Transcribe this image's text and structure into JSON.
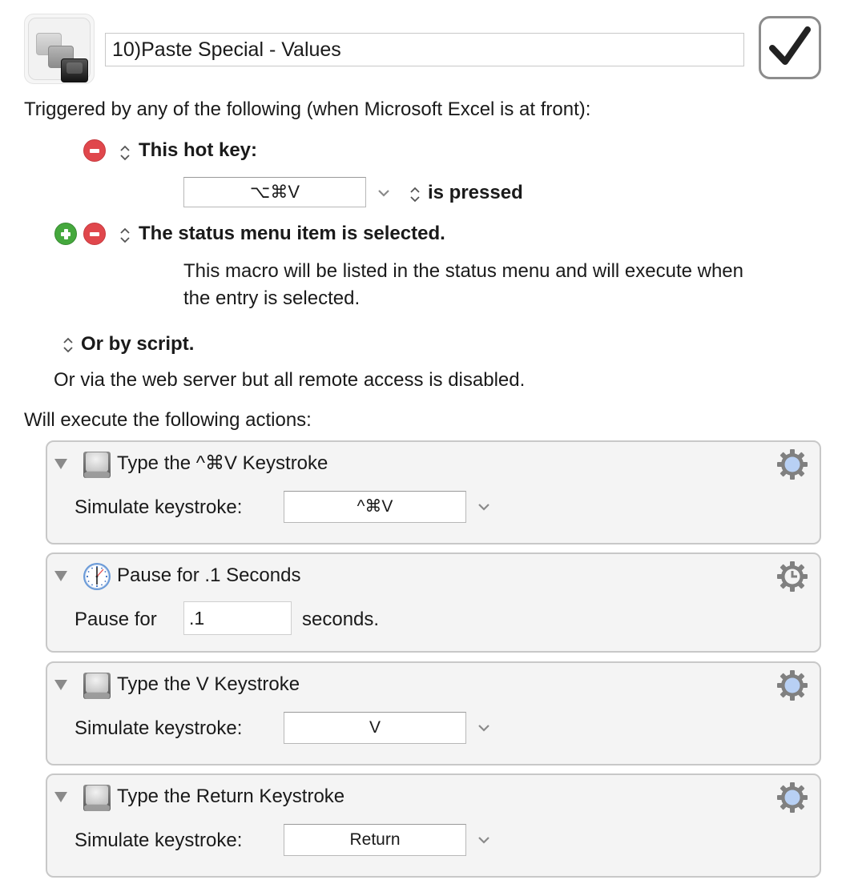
{
  "header": {
    "macro_icon": "keystroke-stack-icon",
    "macro_name": "10)Paste Special - Values",
    "enabled": true,
    "enable_icon": "checkmark-icon"
  },
  "triggers": {
    "heading": "Triggered by any of the following (when Microsoft Excel is at front):",
    "hotkey": {
      "label": "This hot key:",
      "value": "⌥⌘V",
      "condition": "is pressed"
    },
    "status_menu": {
      "label": "The status menu item is selected.",
      "description_line1": "This macro will be listed in the status menu and will execute when",
      "description_line2": "the entry is selected."
    },
    "script": {
      "label": "Or by script."
    },
    "web_server_note": "Or via the web server but all remote access is disabled."
  },
  "actions": {
    "heading": "Will execute the following actions:",
    "items": [
      {
        "title": "Type the ^⌘V Keystroke",
        "icon": "keycap-icon",
        "field_label": "Simulate keystroke:",
        "field_value": "^⌘V",
        "gear_icon": "gear-icon"
      },
      {
        "title": "Pause for .1 Seconds",
        "icon": "clock-icon",
        "field_label": "Pause for",
        "field_value": ".1",
        "field_suffix": "seconds.",
        "gear_icon": "gear-clock-icon"
      },
      {
        "title": "Type the V Keystroke",
        "icon": "keycap-icon",
        "field_label": "Simulate keystroke:",
        "field_value": "V",
        "gear_icon": "gear-icon"
      },
      {
        "title": "Type the Return Keystroke",
        "icon": "keycap-icon",
        "field_label": "Simulate keystroke:",
        "field_value": "Return",
        "gear_icon": "gear-icon"
      }
    ]
  },
  "colors": {
    "remove": "#e0474c",
    "add": "#45a83d",
    "gear": "#808080",
    "gear_center": "#b8d0f4"
  }
}
